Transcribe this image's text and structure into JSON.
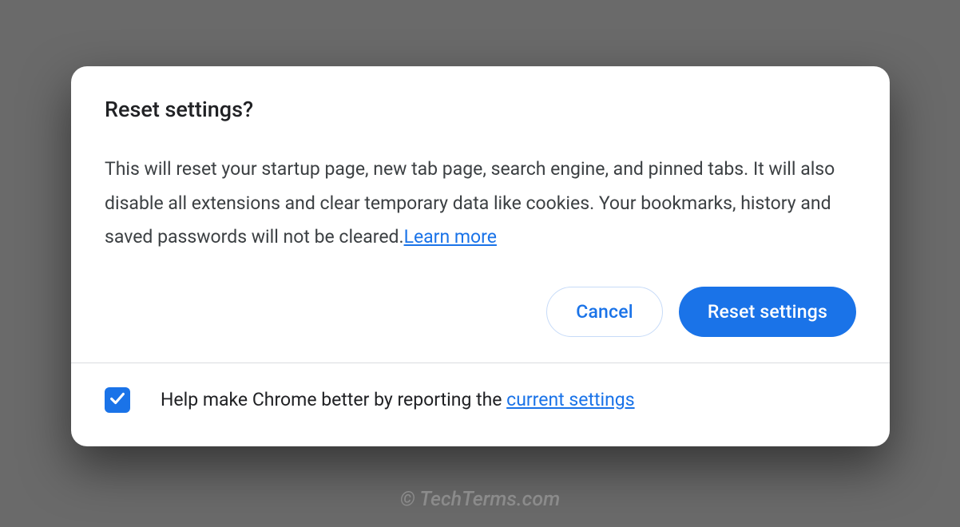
{
  "dialog": {
    "title": "Reset settings?",
    "description": "This will reset your startup page, new tab page, search engine, and pinned tabs. It will also disable all extensions and clear temporary data like cookies. Your bookmarks, history and saved passwords will not be cleared.",
    "learn_more": "Learn more",
    "cancel_label": "Cancel",
    "confirm_label": "Reset settings",
    "footer_text_prefix": "Help make Chrome better by reporting the ",
    "footer_link": "current settings",
    "checkbox_checked": true
  },
  "watermark": "© TechTerms.com"
}
